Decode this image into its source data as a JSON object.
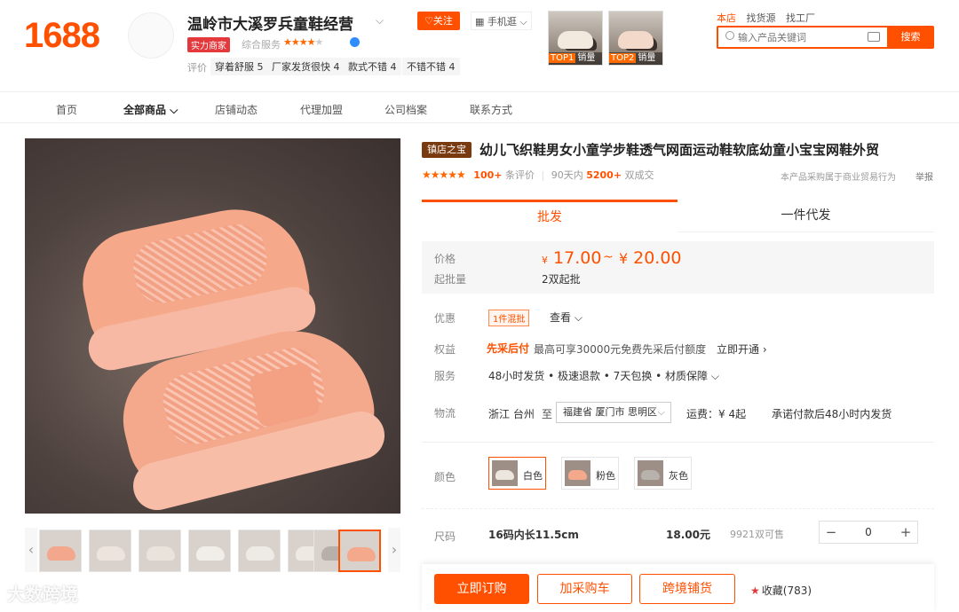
{
  "header": {
    "logo": "1688",
    "shop_name": "温岭市大溪罗兵童鞋经营",
    "strength_badge": "实力商家",
    "service_label": "综合服务",
    "service_stars": "★★★★",
    "review_label": "评价",
    "review_tags": [
      "穿着舒服 5",
      "厂家发货很快 4",
      "款式不错 4",
      "不错不错 4"
    ],
    "follow_label": "♡关注",
    "mobile_label": "手机逛",
    "top_thumbs": [
      {
        "rank": "TOP1",
        "label": "销量"
      },
      {
        "rank": "TOP2",
        "label": "销量"
      }
    ],
    "search_links": [
      "本店",
      "找货源",
      "找工厂"
    ],
    "search_placeholder": "输入产品关键词",
    "search_button": "搜索"
  },
  "nav": {
    "items": [
      "首页",
      "全部商品",
      "店铺动态",
      "代理加盟",
      "公司档案",
      "联系方式"
    ]
  },
  "product": {
    "badge": "镇店之宝",
    "title": "幼儿飞织鞋男女小童学步鞋透气网面运动鞋软底幼童小宝宝网鞋外贸",
    "rating_stars": "★★★★★",
    "review_count": "100+",
    "review_suffix": "条评价",
    "sales_prefix": "90天内",
    "sales_count": "5200+",
    "sales_suffix": "双成交",
    "biz_note": "本产品采购属于商业贸易行为",
    "report": "举报",
    "tabs": [
      "批发",
      "一件代发"
    ],
    "price_label": "价格",
    "currency": "¥",
    "price_low": "17.00",
    "price_sep": "~",
    "price_high": "20.00",
    "moq_label": "起批量",
    "moq_value": "2双起批",
    "promo_label": "优惠",
    "promo_tag": "1件混批",
    "promo_view": "查看 ⌵",
    "equity_label": "权益",
    "equity_hl": "先采后付",
    "equity_text": "最高可享30000元免费先采后付额度",
    "equity_link": "立即开通 ›",
    "service_label": "服务",
    "service_text": "48小时发货 • 极速退款 • 7天包换 • 材质保障 ⌵",
    "logistics_label": "物流",
    "logistics_from": "浙江  台州",
    "logistics_to": "至",
    "logistics_dest": "福建省 厦门市 思明区",
    "logistics_fee": "运费：¥ 4起",
    "logistics_promise": "承诺付款后48小时内发货",
    "color_label": "颜色",
    "colors": [
      {
        "name": "白色",
        "swatch": "#ede6df"
      },
      {
        "name": "粉色",
        "swatch": "#f4a88c"
      },
      {
        "name": "灰色",
        "swatch": "#b8b2ad"
      }
    ],
    "size_label": "尺码",
    "size_name": "16码内长11.5cm",
    "size_price": "18.00元",
    "size_stock": "9921双可售",
    "quantity": "0"
  },
  "actions": {
    "order": "立即订购",
    "cart": "加采购车",
    "cross_border": "跨境铺货",
    "favorite": "收藏(783)"
  },
  "watermark": "大数跨境",
  "colors": {
    "accent": "#ff5000",
    "badge_dark": "#7a3a10"
  }
}
